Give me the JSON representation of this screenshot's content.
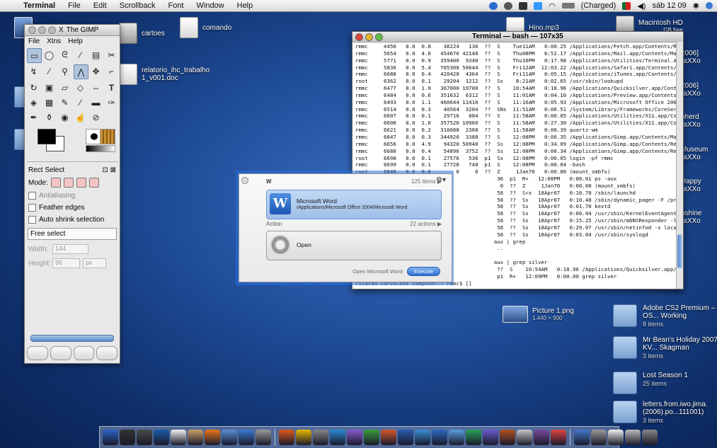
{
  "menubar": {
    "apple": "",
    "items": [
      "Terminal",
      "File",
      "Edit",
      "Scrollback",
      "Font",
      "Window",
      "Help"
    ],
    "battery": "(Charged)",
    "clock": "sáb 12 09"
  },
  "desktop_icons": {
    "cartoes": "cartoes",
    "comando": "comando",
    "hino": "Hino.mp3",
    "relatorio_l1": "relatorio_ihc_trabalho",
    "relatorio_l2": "1_v001.doc",
    "macintosh": "Macintosh HD",
    "macintosh_sub": "GB free",
    "picture": "Picture 1.png",
    "picture_sub": "1.440 × 900"
  },
  "desktop_truncated": [
    "2006]",
    "-aXXo",
    "2006]",
    "-aXXo",
    "pherd",
    "-aXXo",
    "Museum",
    "-aXXo",
    "Happy",
    "-aXXo",
    "nshine",
    "-aXXo"
  ],
  "desktop_list": [
    {
      "name": "Adobe CS2 Premium – Mac OS... Working",
      "sub": "8 items"
    },
    {
      "name": "Mr Bean's Holiday 2007 KV... Skagman",
      "sub": "3 items"
    },
    {
      "name": "Lost Season 1",
      "sub": "25 items"
    },
    {
      "name": "letters.from.iwo.jima.(2006).po...111001)",
      "sub": "3 items"
    }
  ],
  "gimp": {
    "title": "The GIMP",
    "menu": [
      "File",
      "Xtns",
      "Help"
    ],
    "tool_options_title": "Rect Select",
    "mode_label": "Mode:",
    "antialiasing": "Antialiasing",
    "feather": "Feather edges",
    "autoshrink": "Auto shrink selection",
    "select": "Free select",
    "width_label": "Width:",
    "width_value": "144",
    "height_label": "Height:",
    "height_value": "96",
    "unit": "px"
  },
  "terminal": {
    "title": "Terminal — bash — 107x35",
    "lines": [
      "rmmc     4456   0.0  0.8    38224   136  ??  S    Tue11AM   0:00.25 /Applications/Fetch.app/Contents/Reso",
      "rmmc     5654   0.0  4.0   454676 42148  ??  S    Thu08PM   6:52.17 /Applications/Mail.app/Contents/MacOS",
      "rmmc     5771   0.0  0.9   359400  9340  ??  S    Thu10PM   0:17.98 /Applications/Utilities/Terminal.app/",
      "rmmc     5836   0.0  5.4   705308 56644  ??  S    Fri12AM  12:03.22 /Applications/Safari.app/Contents/Mac",
      "rmmc     6088   0.0  0.4   420428  4364  ??  S    Fri11AM   0:05.15 /Applications/iTunes.app/Contents/Mac",
      "root     6362   0.0  0.1    29204  1212  ??  Ss    8:21AM   0:02.65 /usr/sbin/lookupd",
      "rmmc     6477   0.0  1.9   367000 19700  ??  S    10:54AM   0:18.96 /Applications/Quicksilver.app/Content",
      "rmmc     6484   0.0  0.6   351632  6312  ??  S    11:01AM   0:04.10 /Applications/Preview.app/Contents/Ma",
      "rmmc     6493   0.0  1.1   460644 11416  ??  S    11:16AM   0:05.93 /Applications/Microsoft Office 2004/O",
      "rmmc     6514   0.0  0.3    40564  3204  ??  SNs  11:51AM   0:00.51 /System/Library/Frameworks/CoreServic",
      "rmmc     6607   0.0  0.1    29716   884  ??  S    11:58AM   0:00.05 /Applications/Utilities/X11.app/Conte",
      "rmmc     6608   0.0  1.0   357520 10960  ??  S    11:58AM   0:27.30 /Applications/Utilities/X11.app/Conte",
      "rmmc     6621   0.0  0.2   310088  2368  ??  S    11:58AM   0:00.39 quartz-wm",
      "rmmc     6647   0.0  0.3   344920  3388  ??  S    12:08PM   0:00.35 /Applications/Gimp.app/Contents/MacOS",
      "rmmc     6656   0.0  4.9    94320 50940  ??  Ss   12:08PM   0:34.09 /Applications/Gimp.app/Contents/Resou",
      "rmmc     6688   0.0  0.4    54896  3752  ??  Ss   12:08PM   0:00.34 /Applications/Gimp.app/Contents/Resou",
      "root     6698   0.0  0.1    27576   536  p1  Ss   12:08PM   0:00.05 login -pf rmmc",
      "rmmc     6699   0.0  0.1    27728   748  p1  S    12:08PM   0:00.04 -bash",
      "root     6840   0.0  0.0        0     0  ??  Z     1Jan70   0:00.00 (mount_smbfs)",
      "                                             36  p1  R+   12:08PM   0:00.01 ps -aux",
      "                                              0  ??  Z     1Jan70   0:00.00 (mount_smbfs)",
      "                                             58  ??  S<s  18Apr07   0:10.70 /sbin/launchd",
      "                                             58  ??  Ss   18Apr07   0:10.48 /sbin/dynamic_pager -F /private/var/v",
      "                                             58  ??  Ss   18Apr07   0:01.70 kextd",
      "                                             58  ??  Ss   18Apr07   0:00.04 /usr/sbin/KernelEventAgent",
      "                                             58  ??  Ss   18Apr07   0:15.25 /usr/sbin/mDNSResponder -launchdaemon",
      "                                             58  ??  Ss   18Apr07   0:29.07 /usr/sbin/netinfod -s local",
      "                                             58  ??  Ss   18Apr07   0:03.04 /usr/sbin/syslogd",
      "                                            aux | grep",
      "                                             ..",
      "",
      "                                            aux | grep silver",
      "                                             ??  S    10:54AM   0:18.96 /Applications/Quicksilver.app/Content",
      "                                             p1  R+   12:09PM   0:00.00 grep silver",
      "ricardo-carvalhos-computer:~ rmmc$ []"
    ]
  },
  "quicksilver": {
    "search": "W",
    "items_count": "125 items",
    "item_title": "Microsoft Word",
    "item_path": "/Applications/Microsoft Office 2004/Microsoft Word",
    "action_label": "Action",
    "actions_count": "22 actions",
    "action_name": "Open",
    "footer_text": "Open Microsoft Word",
    "execute": "Execute"
  },
  "dock_colors": [
    "#2d64c8",
    "#333333",
    "#4a4a4a",
    "#1a5ba8",
    "#f2f2f2",
    "#c9a06a",
    "#e8761c",
    "#5a8fd8",
    "#3a7bd5",
    "#9a9a9a",
    "#e05a1c",
    "#e6b800",
    "#888888",
    "#2a8bd6",
    "#8a5bd0",
    "#3b9d3b",
    "#d65a2a",
    "#2a5ab0",
    "#3b8fd6",
    "#2c68c0",
    "#5aa0e0",
    "#2aa05a",
    "#6a5acd",
    "#b05020",
    "#c8c8c8",
    "#7a4a9a",
    "#dd4444",
    "#4477cc",
    "#999999",
    "#f0f0f0",
    "#bbbbbb",
    "#888888"
  ]
}
